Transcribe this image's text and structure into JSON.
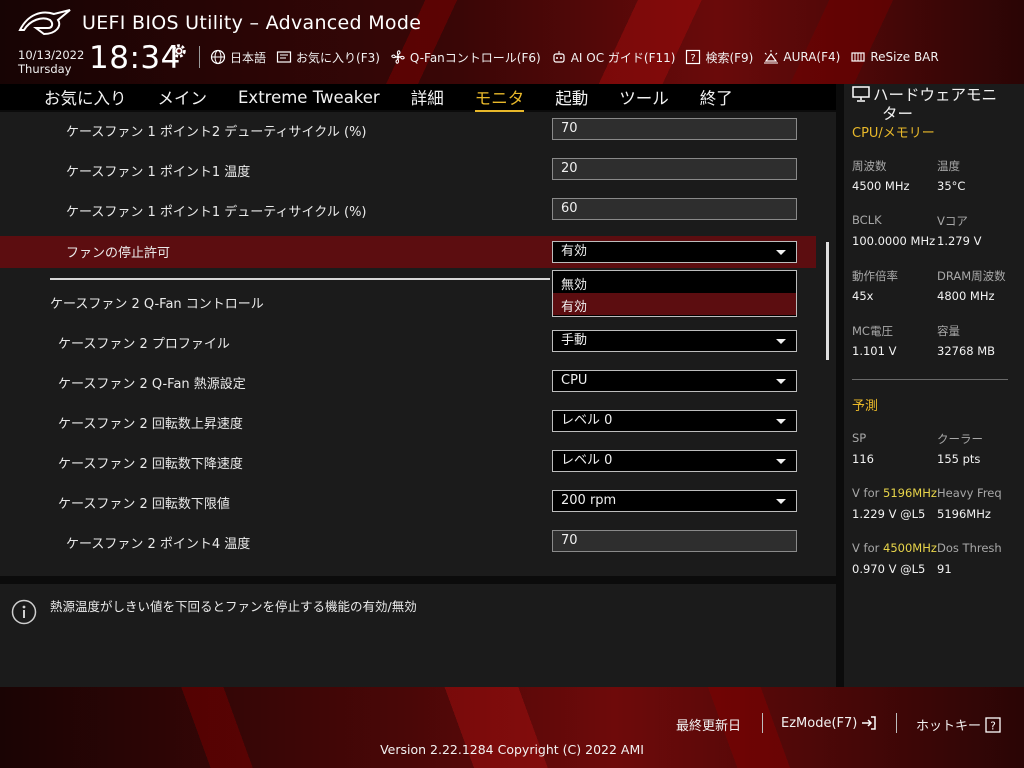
{
  "header": {
    "title": "UEFI BIOS Utility – Advanced Mode",
    "date": "10/13/2022",
    "day": "Thursday",
    "time": "18:34",
    "tools": [
      {
        "label": "日本語",
        "icon": "globe-icon"
      },
      {
        "label": "お気に入り(F3)",
        "icon": "favorites-icon"
      },
      {
        "label": "Q-Fanコントロール(F6)",
        "icon": "fan-icon"
      },
      {
        "label": "AI OC ガイド(F11)",
        "icon": "ai-oc-icon"
      },
      {
        "label": "検索(F9)",
        "icon": "help-search-icon"
      },
      {
        "label": "AURA(F4)",
        "icon": "aura-icon"
      },
      {
        "label": "ReSize BAR",
        "icon": "resize-bar-icon"
      }
    ]
  },
  "tabs": [
    {
      "label": "お気に入り",
      "active": false
    },
    {
      "label": "メイン",
      "active": false
    },
    {
      "label": "Extreme Tweaker",
      "active": false
    },
    {
      "label": "詳細",
      "active": false
    },
    {
      "label": "モニタ",
      "active": true
    },
    {
      "label": "起動",
      "active": false
    },
    {
      "label": "ツール",
      "active": false
    },
    {
      "label": "終了",
      "active": false
    }
  ],
  "settings": [
    {
      "label": "ケースファン 1 ポイント2 デューティサイクル (%)",
      "value": "70",
      "type": "input"
    },
    {
      "label": "ケースファン 1 ポイント1 温度",
      "value": "20",
      "type": "input"
    },
    {
      "label": "ケースファン 1 ポイント1 デューティサイクル (%)",
      "value": "60",
      "type": "input"
    },
    {
      "label": "ファンの停止許可",
      "value": "有効",
      "type": "select"
    },
    {
      "label": "ケースファン 2 Q-Fan コントロール",
      "value": "",
      "type": "header"
    },
    {
      "label": "ケースファン 2 プロファイル",
      "value": "手動",
      "type": "select"
    },
    {
      "label": "ケースファン 2 Q-Fan 熱源設定",
      "value": "CPU",
      "type": "select"
    },
    {
      "label": "ケースファン 2 回転数上昇速度",
      "value": "レベル 0",
      "type": "select"
    },
    {
      "label": "ケースファン 2 回転数下降速度",
      "value": "レベル 0",
      "type": "select"
    },
    {
      "label": "ケースファン 2 回転数下限値",
      "value": "200 rpm",
      "type": "select"
    },
    {
      "label": "ケースファン 2 ポイント4 温度",
      "value": "70",
      "type": "input"
    }
  ],
  "dropdown": {
    "options": [
      "無効",
      "有効"
    ]
  },
  "help": {
    "text": "熱源温度がしきい値を下回るとファンを停止する機能の有効/無効"
  },
  "hardware": {
    "title_line1": "ハードウェアモニ",
    "title_line2": "ター",
    "cpu_section": "CPU/メモリー",
    "freq_label": "周波数",
    "freq_value": "4500 MHz",
    "temp_label": "温度",
    "temp_value": "35°C",
    "bclk_label": "BCLK",
    "bclk_value": "100.0000 MHz",
    "vcore_label": "Vコア",
    "vcore_value": "1.279 V",
    "ratio_label": "動作倍率",
    "ratio_value": "45x",
    "dram_label": "DRAM周波数",
    "dram_value": "4800 MHz",
    "mc_label": "MC電圧",
    "mc_value": "1.101 V",
    "cap_label": "容量",
    "cap_value": "32768 MB",
    "predict_section": "予測",
    "sp_label": "SP",
    "sp_value": "116",
    "cooler_label": "クーラー",
    "cooler_value": "155 pts",
    "vfor1_prefix": "V for ",
    "vfor1_freq": "5196MHz",
    "vfor1_value": "1.229 V @L5",
    "heavy_label": "Heavy Freq",
    "heavy_value": "5196MHz",
    "vfor2_prefix": "V for ",
    "vfor2_freq": "4500MHz",
    "vfor2_value": "0.970 V @L5",
    "dos_label": "Dos Thresh",
    "dos_value": "91"
  },
  "footer": {
    "last_modified": "最終更新日",
    "ezmode": "EzMode(F7)",
    "hotkey": "ホットキー",
    "version": "Version 2.22.1284 Copyright (C) 2022 AMI"
  },
  "colors": {
    "accent": "#e8b82a",
    "selected_row": "#5c0d10",
    "panel": "#1b1b1b"
  }
}
